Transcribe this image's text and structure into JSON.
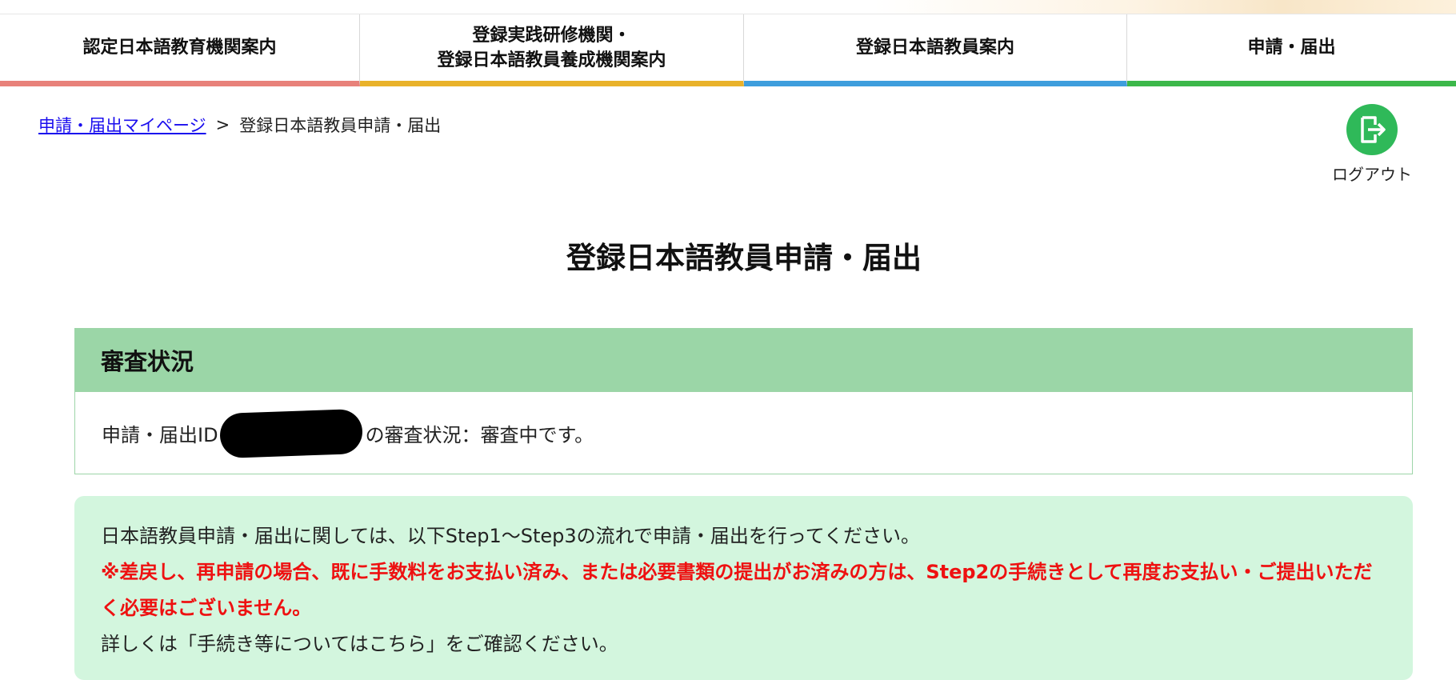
{
  "nav": {
    "items": [
      {
        "label": "認定日本語教育機関案内",
        "color": "#e8817a"
      },
      {
        "label": "登録実践研修機関・\n登録日本語教員養成機関案内",
        "color": "#e9b22a"
      },
      {
        "label": "登録日本語教員案内",
        "color": "#3e9edd"
      },
      {
        "label": "申請・届出",
        "color": "#3cb84a"
      }
    ]
  },
  "breadcrumb": {
    "link": "申請・届出マイページ",
    "separator": ">",
    "current": "登録日本語教員申請・届出"
  },
  "logout": {
    "label": "ログアウト",
    "icon": "logout-icon",
    "color": "#2fb959"
  },
  "page": {
    "title": "登録日本語教員申請・届出"
  },
  "status": {
    "heading": "審査状況",
    "text_before": "申請・届出ID",
    "text_after": "の審査状況：審査中です。"
  },
  "info": {
    "line1": "日本語教員申請・届出に関しては、以下Step1～Step3の流れで申請・届出を行ってください。",
    "warning": "※差戻し、再申請の場合、既に手数料をお支払い済み、または必要書類の提出がお済みの方は、Step2の手続きとして再度お支払い・ご提出いただく必要はございません。",
    "line3": "詳しくは「手続き等についてはこちら」をご確認ください。"
  }
}
